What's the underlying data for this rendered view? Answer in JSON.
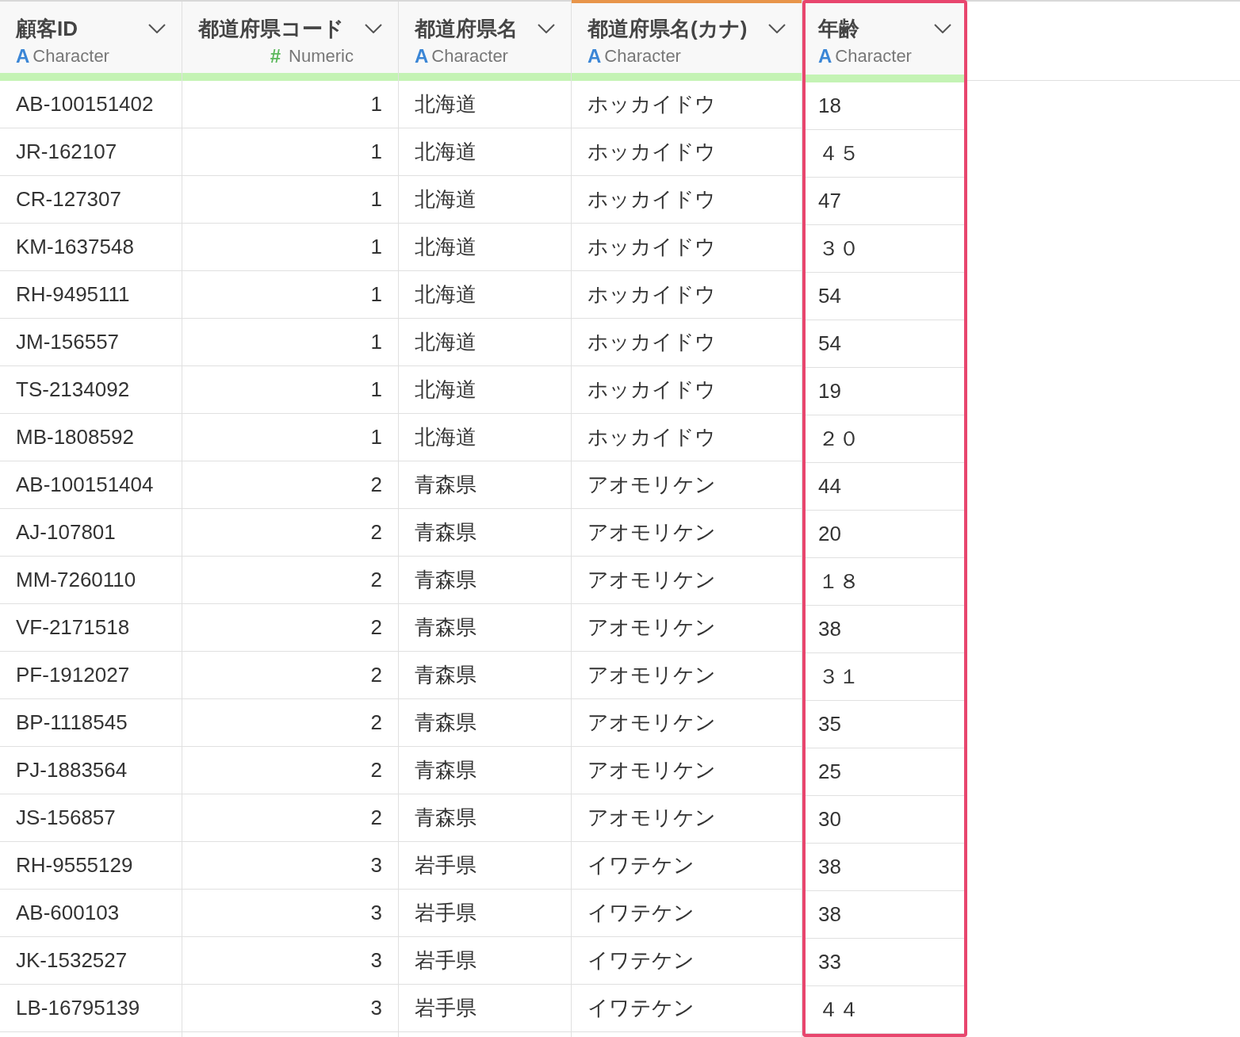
{
  "columns": [
    {
      "title": "顧客ID",
      "type_icon": "A",
      "type": "Character",
      "kind": "character",
      "selected": false,
      "highlighted": false
    },
    {
      "title": "都道府県コード",
      "type_icon": "#",
      "type": "Numeric",
      "kind": "numeric",
      "selected": false,
      "highlighted": false
    },
    {
      "title": "都道府県名",
      "type_icon": "A",
      "type": "Character",
      "kind": "character",
      "selected": false,
      "highlighted": false
    },
    {
      "title": "都道府県名(カナ)",
      "type_icon": "A",
      "type": "Character",
      "kind": "character",
      "selected": true,
      "highlighted": false
    },
    {
      "title": "年齢",
      "type_icon": "A",
      "type": "Character",
      "kind": "character",
      "selected": false,
      "highlighted": true
    }
  ],
  "rows": [
    [
      "AB-100151402",
      "1",
      "北海道",
      "ホッカイドウ",
      "18"
    ],
    [
      "JR-162107",
      "1",
      "北海道",
      "ホッカイドウ",
      "４５"
    ],
    [
      "CR-127307",
      "1",
      "北海道",
      "ホッカイドウ",
      "47"
    ],
    [
      "KM-1637548",
      "1",
      "北海道",
      "ホッカイドウ",
      "３０"
    ],
    [
      "RH-9495111",
      "1",
      "北海道",
      "ホッカイドウ",
      "54"
    ],
    [
      "JM-156557",
      "1",
      "北海道",
      "ホッカイドウ",
      "54"
    ],
    [
      "TS-2134092",
      "1",
      "北海道",
      "ホッカイドウ",
      "19"
    ],
    [
      "MB-1808592",
      "1",
      "北海道",
      "ホッカイドウ",
      "２０"
    ],
    [
      "AB-100151404",
      "2",
      "青森県",
      "アオモリケン",
      "44"
    ],
    [
      "AJ-107801",
      "2",
      "青森県",
      "アオモリケン",
      "20"
    ],
    [
      "MM-7260110",
      "2",
      "青森県",
      "アオモリケン",
      "１８"
    ],
    [
      "VF-2171518",
      "2",
      "青森県",
      "アオモリケン",
      "38"
    ],
    [
      "PF-1912027",
      "2",
      "青森県",
      "アオモリケン",
      "３１"
    ],
    [
      "BP-1118545",
      "2",
      "青森県",
      "アオモリケン",
      "35"
    ],
    [
      "PJ-1883564",
      "2",
      "青森県",
      "アオモリケン",
      "25"
    ],
    [
      "JS-156857",
      "2",
      "青森県",
      "アオモリケン",
      "30"
    ],
    [
      "RH-9555129",
      "3",
      "岩手県",
      "イワテケン",
      "38"
    ],
    [
      "AB-600103",
      "3",
      "岩手県",
      "イワテケン",
      "38"
    ],
    [
      "JK-1532527",
      "3",
      "岩手県",
      "イワテケン",
      "33"
    ],
    [
      "LB-16795139",
      "3",
      "岩手県",
      "イワテケン",
      "４４"
    ]
  ]
}
